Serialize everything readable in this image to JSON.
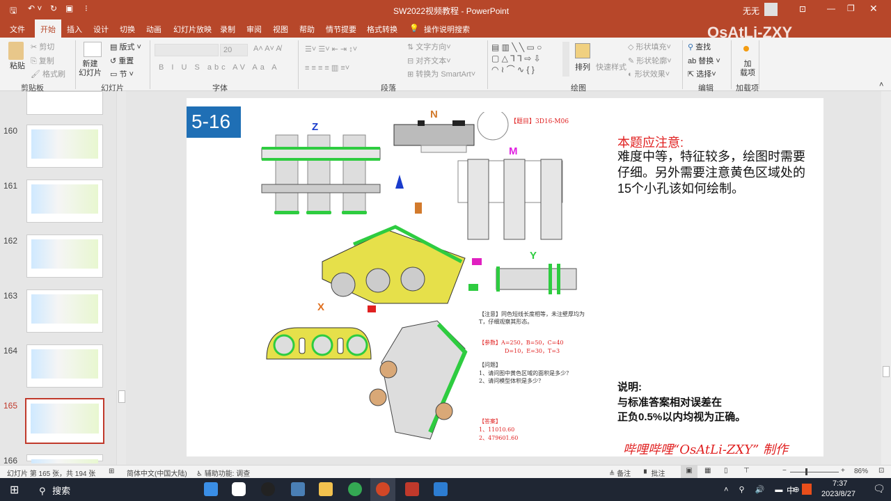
{
  "titlebar": {
    "title": "SW2022视频教程  -  PowerPoint",
    "user": "无无",
    "watermark": "OsAtLi-ZXY"
  },
  "tabs": [
    "文件",
    "开始",
    "插入",
    "设计",
    "切换",
    "动画",
    "幻灯片放映",
    "录制",
    "审阅",
    "视图",
    "帮助",
    "情节提要",
    "格式转换",
    "操作说明搜索"
  ],
  "ribbon": {
    "clipboard": {
      "paste": "粘贴",
      "cut": "剪切",
      "copy": "复制",
      "format_painter": "格式刷",
      "label": "剪贴板"
    },
    "slides": {
      "new_slide": "新建\n幻灯片",
      "layout": "版式",
      "reset": "重置",
      "section": "节",
      "label": "幻灯片"
    },
    "font": {
      "size": "20",
      "label": "字体"
    },
    "paragraph": {
      "text_direction": "文字方向",
      "align_text": "对齐文本",
      "smartart": "转换为 SmartArt",
      "label": "段落"
    },
    "drawing": {
      "arrange": "排列",
      "quick_styles": "快速样式",
      "shape_fill": "形状填充",
      "shape_outline": "形状轮廓",
      "shape_effects": "形状效果",
      "label": "绘图"
    },
    "editing": {
      "find": "查找",
      "replace": "替换",
      "select": "选择",
      "label": "编辑"
    },
    "addins": {
      "addins": "加\n载项",
      "label": "加载项"
    }
  },
  "thumbnails": [
    {
      "n": "160"
    },
    {
      "n": "161"
    },
    {
      "n": "162"
    },
    {
      "n": "163"
    },
    {
      "n": "164"
    },
    {
      "n": "165",
      "selected": true
    },
    {
      "n": "166"
    }
  ],
  "slide": {
    "badge": "5-16",
    "problem_id": "【题目】3D16-M06",
    "views": {
      "z": "Z",
      "n": "N",
      "m": "M",
      "y": "Y",
      "x": "X"
    },
    "note": "【注意】同色短线长度相等，未注壁厚均为T，仔细观察其形态。",
    "params_1": "【参数】A=250，B=50，C=40",
    "params_2": "D=10，E=30，T=3",
    "questions_title": "【问题】",
    "q1": "1、请问图中黄色区域的面积是多少？",
    "q2": "2、请问模型体积是多少？",
    "answers_title": "【答案】",
    "a1": "1、11010.60",
    "a2": "2、479601.60",
    "attention_title": "本题应注意:",
    "attention_body": "难度中等，特征较多，绘图时需要仔细。另外需要注意黄色区域处的15个小孔该如何绘制。",
    "explain_title": "说明:",
    "explain_1": "与标准答案相对误差在",
    "explain_2": "正负0.5%以内均视为正确。",
    "signature": "哔哩哔哩“OsAtLi-ZXY” 制作"
  },
  "status": {
    "slide_info": "幻灯片 第 165 张，共 194 张",
    "language": "简体中文(中国大陆)",
    "accessibility": "辅助功能: 调查",
    "notes": "备注",
    "comments": "批注",
    "zoom": "86%"
  },
  "taskbar": {
    "search": "搜索",
    "time": "7:37",
    "date": "2023/8/27",
    "ime": "中"
  }
}
